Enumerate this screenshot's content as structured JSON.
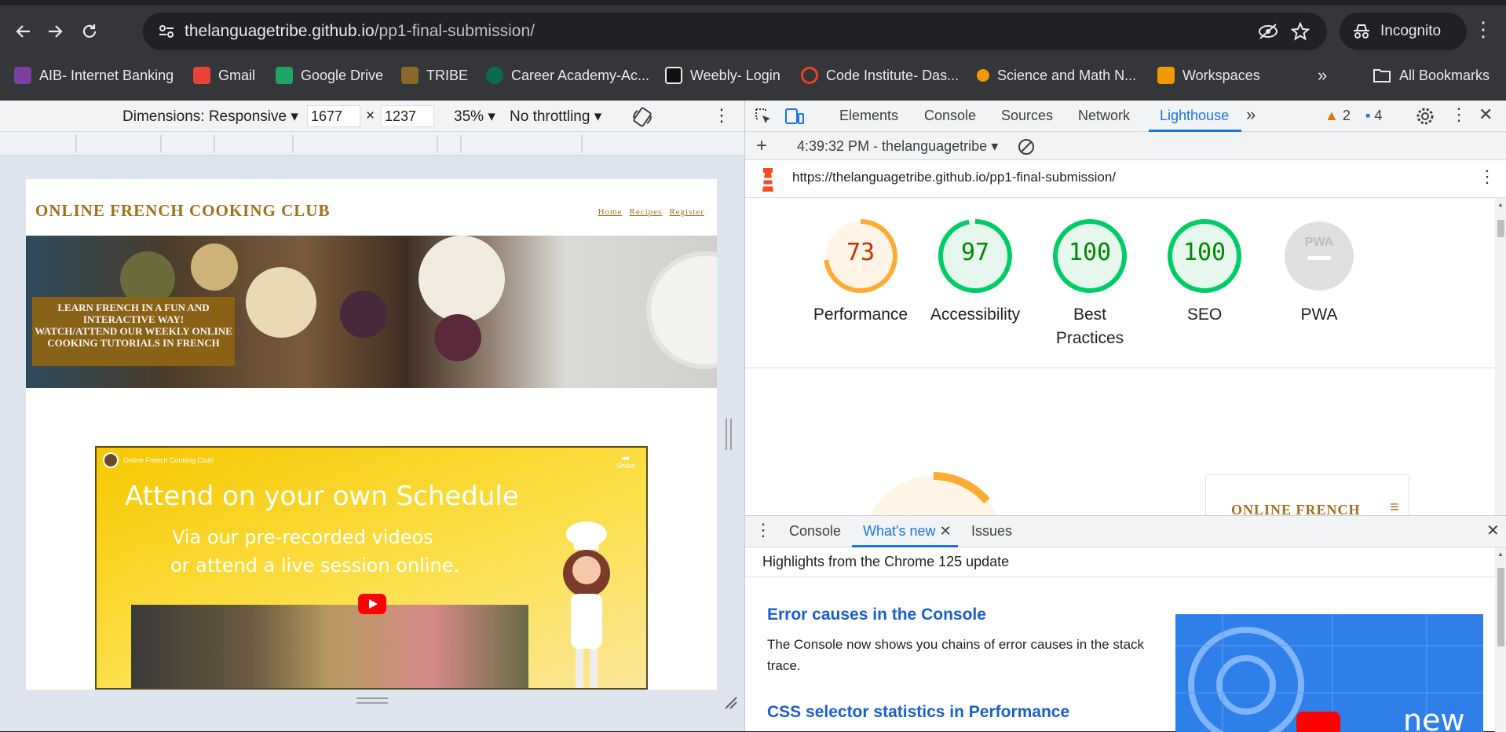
{
  "browser": {
    "url_host": "thelanguagetribe.github.io",
    "url_path": "/pp1-final-submission/",
    "incognito_label": "Incognito",
    "bookmarks": [
      {
        "label": "AIB- Internet Banking",
        "icon": "aib-icon",
        "color": "#7b3fa0"
      },
      {
        "label": "Gmail",
        "icon": "gmail-icon",
        "color": "#ea4335"
      },
      {
        "label": "Google Drive",
        "icon": "google-drive-icon",
        "color": "#1fa463"
      },
      {
        "label": "TRIBE",
        "icon": "tribe-icon",
        "color": "#8a6a2a"
      },
      {
        "label": "Career Academy-Ac...",
        "icon": "career-academy-icon",
        "color": "#0b6b4f"
      },
      {
        "label": "Weebly- Login",
        "icon": "weebly-icon",
        "color": "#111111"
      },
      {
        "label": "Code Institute- Das...",
        "icon": "code-institute-icon",
        "color": "#e8451e"
      },
      {
        "label": "Science and Math N...",
        "icon": "science-math-icon",
        "color": "#f29900"
      },
      {
        "label": "Workspaces",
        "icon": "workspaces-icon",
        "color": "#f29900"
      }
    ],
    "all_bookmarks_label": "All Bookmarks"
  },
  "device_toolbar": {
    "dimensions_label": "Dimensions: Responsive",
    "width": "1677",
    "times": "×",
    "height": "1237",
    "zoom": "35%",
    "throttling": "No throttling"
  },
  "site": {
    "title": "ONLINE FRENCH COOKING CLUB",
    "nav": [
      "Home",
      "Recipes",
      "Register"
    ],
    "hero_lines": [
      "LEARN FRENCH IN A FUN AND",
      "INTERACTIVE WAY!",
      "WATCH/ATTEND OUR WEEKLY ONLINE",
      "COOKING TUTORIALS IN FRENCH"
    ],
    "video": {
      "channel": "Online French Cooking Club!",
      "share": "Share",
      "headline": "Attend on your own Schedule",
      "line2": "Via our pre-recorded videos",
      "line3": "or attend a live session online."
    }
  },
  "devtools": {
    "tabs": [
      "Elements",
      "Console",
      "Sources",
      "Network",
      "Lighthouse"
    ],
    "active_tab": "Lighthouse",
    "warnings_count": "2",
    "messages_count": "4",
    "report_time": "4:39:32 PM - thelanguagetribe",
    "report_url": "https://thelanguagetribe.github.io/pp1-final-submission/",
    "scores": [
      {
        "label": "Performance",
        "value": "73",
        "fraction": 0.73,
        "color": "#fa3"
      },
      {
        "label": "Accessibility",
        "value": "97",
        "fraction": 0.97,
        "color": "#0c6"
      },
      {
        "label": "Best\nPractices",
        "value": "100",
        "fraction": 1.0,
        "color": "#0c6"
      },
      {
        "label": "SEO",
        "value": "100",
        "fraction": 1.0,
        "color": "#0c6"
      },
      {
        "label": "PWA",
        "value": "PWA",
        "fraction": 0,
        "color": "#cccccc"
      }
    ],
    "preview_title": "ONLINE FRENCH",
    "drawer": {
      "tabs": [
        "Console",
        "What's new",
        "Issues"
      ],
      "active_tab": "What's new",
      "highlights": "Highlights from the Chrome 125 update",
      "heading1": "Error causes in the Console",
      "text1": "The Console now shows you chains of error causes in the stack trace.",
      "heading2": "CSS selector statistics in Performance",
      "thumb_text": "new"
    }
  }
}
